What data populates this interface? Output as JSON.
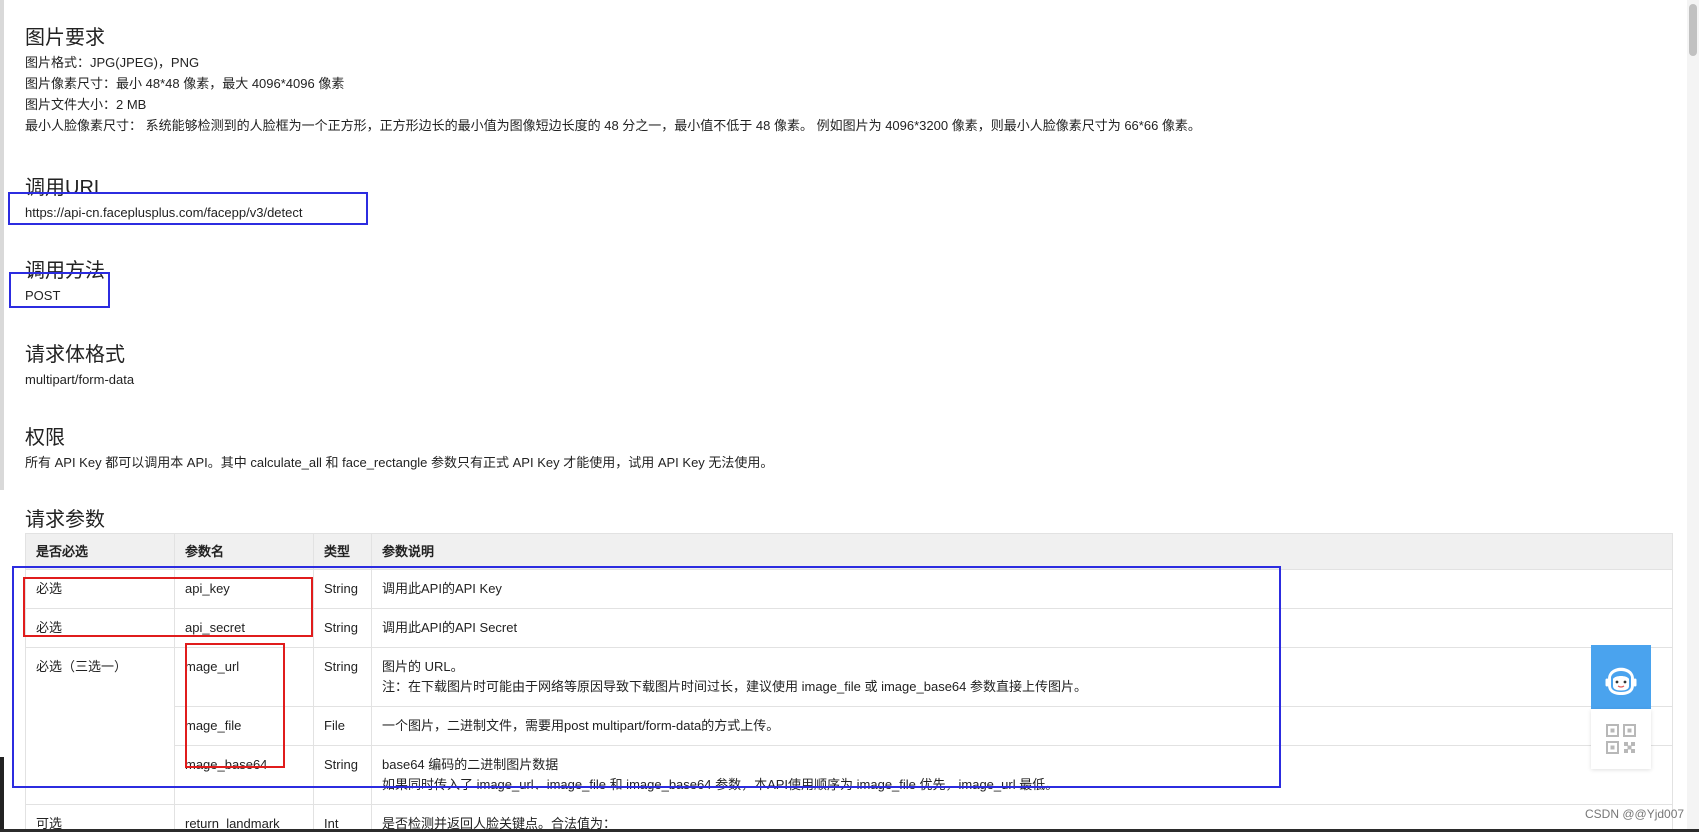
{
  "sections": {
    "image_req": {
      "title": "图片要求",
      "lines": [
        "图片格式：JPG(JPEG)，PNG",
        "图片像素尺寸：最小 48*48 像素，最大 4096*4096 像素",
        "图片文件大小：2 MB",
        "最小人脸像素尺寸： 系统能够检测到的人脸框为一个正方形，正方形边长的最小值为图像短边长度的 48 分之一，最小值不低于 48 像素。 例如图片为 4096*3200 像素，则最小人脸像素尺寸为 66*66 像素。"
      ]
    },
    "url": {
      "title": "调用URL",
      "value": "https://api-cn.faceplusplus.com/facepp/v3/detect"
    },
    "method": {
      "title": "调用方法",
      "value": "POST"
    },
    "body_format": {
      "title": "请求体格式",
      "value": "multipart/form-data"
    },
    "permission": {
      "title": "权限",
      "value": "所有 API Key 都可以调用本 API。其中 calculate_all 和 face_rectangle 参数只有正式 API Key 才能使用，试用 API Key 无法使用。"
    },
    "params": {
      "title": "请求参数"
    }
  },
  "table": {
    "headers": [
      "是否必选",
      "参数名",
      "类型",
      "参数说明"
    ],
    "rows": [
      {
        "required": "必选",
        "name": "api_key",
        "type": "String",
        "desc": [
          "调用此API的API Key"
        ]
      },
      {
        "required": "必选",
        "name": "api_secret",
        "type": "String",
        "desc": [
          "调用此API的API Secret"
        ]
      },
      {
        "required": "必选（三选一）",
        "name": "mage_url",
        "type": "String",
        "desc": [
          "图片的 URL。",
          "注：在下载图片时可能由于网络等原因导致下载图片时间过长，建议使用 image_file 或 image_base64 参数直接上传图片。"
        ]
      },
      {
        "required": "",
        "name": "mage_file",
        "type": "File",
        "desc": [
          "一个图片，二进制文件，需要用post multipart/form-data的方式上传。"
        ]
      },
      {
        "required": "",
        "name": "mage_base64",
        "type": "String",
        "desc": [
          "base64 编码的二进制图片数据",
          "如果同时传入了 image_url、image_file 和 image_base64 参数，本API使用顺序为 image_file 优先，image_url 最低。"
        ]
      },
      {
        "required": "可选",
        "name": "return_landmark",
        "type": "Int",
        "desc": [
          "是否检测并返回人脸关键点。合法值为："
        ]
      }
    ]
  },
  "watermark": "CSDN @@Yjd007",
  "colors": {
    "highlight_blue": "#2c2ce0",
    "highlight_red": "#e01c1c",
    "support_blue": "#4aa3ee"
  },
  "icons": {
    "support": "customer-service-avatar-icon",
    "qr": "qr-code-icon"
  }
}
